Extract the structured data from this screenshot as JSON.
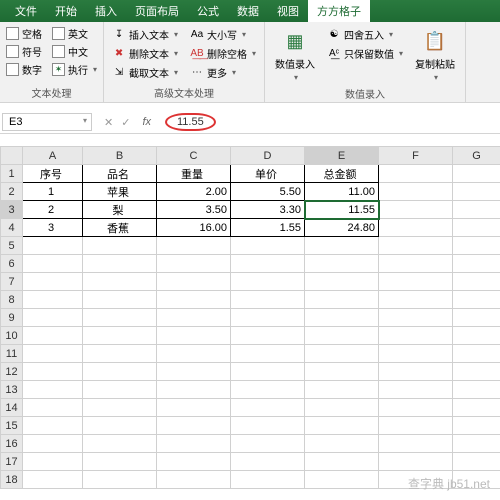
{
  "tabs": {
    "file": "文件",
    "home": "开始",
    "insert": "插入",
    "layout": "页面布局",
    "formulas": "公式",
    "data": "数据",
    "view": "视图",
    "addin": "方方格子"
  },
  "checks": {
    "space": "空格",
    "eng": "英文",
    "symbol": "符号",
    "chinese": "中文",
    "number": "数字",
    "exec": "执行"
  },
  "mid": {
    "insertText": "插入文本",
    "deleteText": "删除文本",
    "extractText": "截取文本",
    "caseChange": "大小写",
    "delSpace": "删除空格",
    "more": "更多"
  },
  "groupLabels": {
    "text": "文本处理",
    "advText": "高级文本处理",
    "numInput": "数值录入"
  },
  "right": {
    "numRec": "数值录入",
    "round": "四舍五入",
    "keepNum": "只保留数值",
    "paste": "复制粘贴"
  },
  "namebox": "E3",
  "formula": "11.55",
  "cols": [
    "A",
    "B",
    "C",
    "D",
    "E",
    "F",
    "G"
  ],
  "headers": {
    "seq": "序号",
    "name": "品名",
    "weight": "重量",
    "price": "单价",
    "total": "总金额"
  },
  "rows": [
    {
      "seq": "1",
      "name": "苹果",
      "weight": "2.00",
      "price": "5.50",
      "total": "11.00"
    },
    {
      "seq": "2",
      "name": "梨",
      "weight": "3.50",
      "price": "3.30",
      "total": "11.55"
    },
    {
      "seq": "3",
      "name": "香蕉",
      "weight": "16.00",
      "price": "1.55",
      "total": "24.80"
    }
  ],
  "watermark": "查字典 jb51.net"
}
